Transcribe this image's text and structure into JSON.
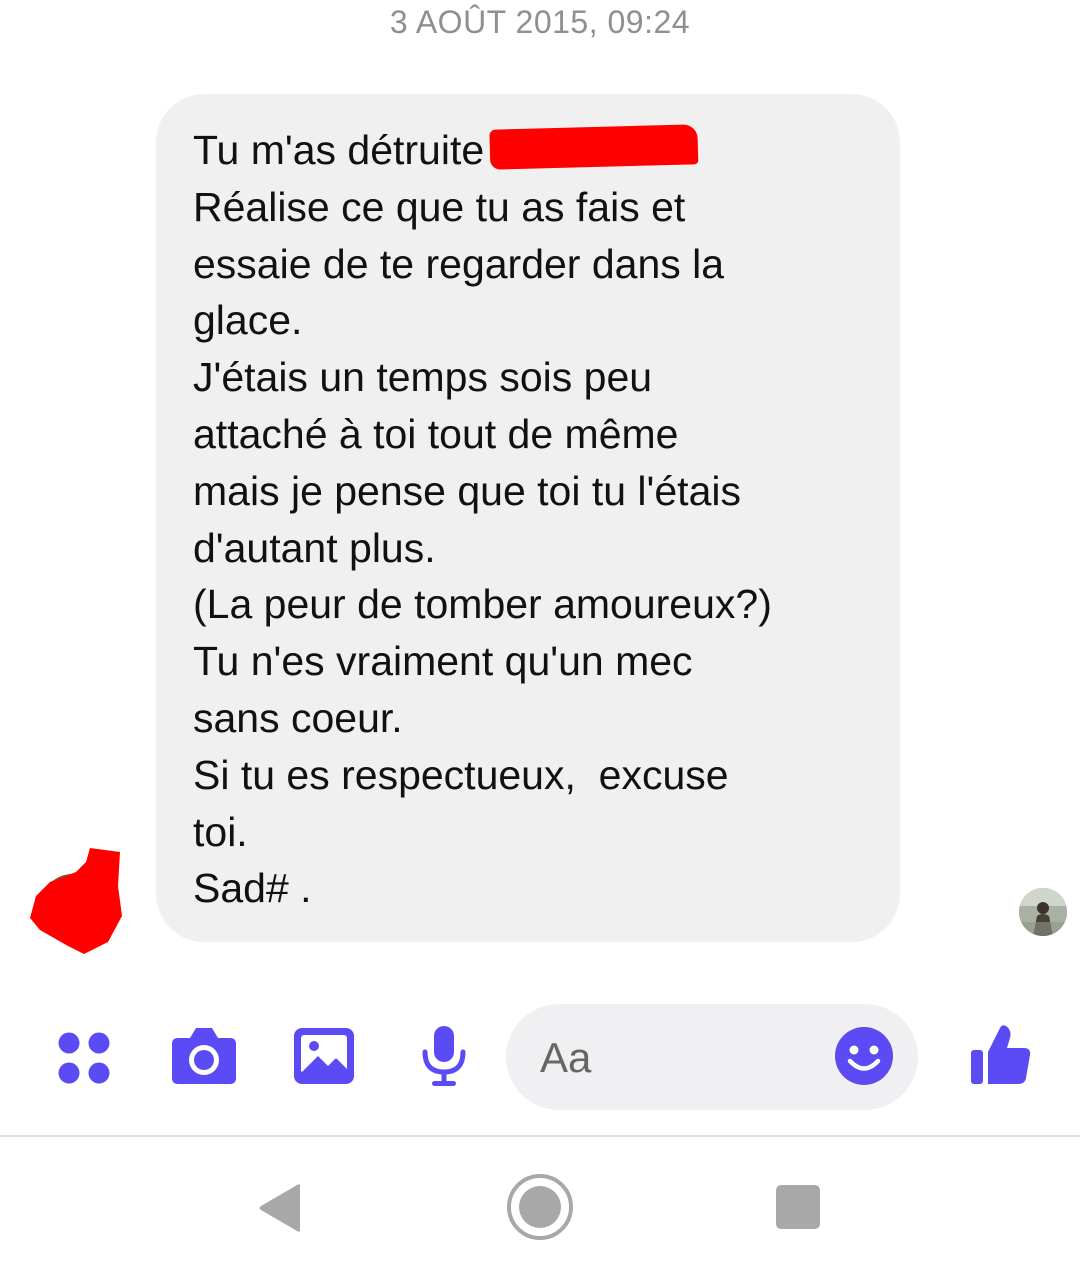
{
  "conversation": {
    "timestamp": "3 AOÛT 2015, 09:24",
    "message": {
      "lines": [
        "Tu m'as détruite",
        "Réalise ce que tu as fais et",
        "essaie de te regarder dans la",
        "glace.",
        "J'étais un temps sois peu",
        "attaché à toi tout de même",
        "mais je pense que toi tu l'étais",
        "d'autant plus.",
        "(La peur de tomber amoureux?)",
        "Tu n'es vraiment qu'un mec",
        "sans coeur.",
        "Si tu es respectueux,  excuse",
        "toi.",
        "Sad# ."
      ]
    }
  },
  "composer": {
    "placeholder": "Aa",
    "icons": {
      "menu": "apps-dots-icon",
      "camera": "camera-icon",
      "gallery": "image-icon",
      "mic": "microphone-icon",
      "emoji": "emoji-icon",
      "like": "thumbs-up-icon"
    },
    "accent_color": "#5b4bf5"
  },
  "navigation": {
    "icons": [
      "back-triangle-icon",
      "home-circle-icon",
      "recents-square-icon"
    ],
    "icon_color": "#a8a8a8"
  },
  "redaction_color": "#ff0000"
}
